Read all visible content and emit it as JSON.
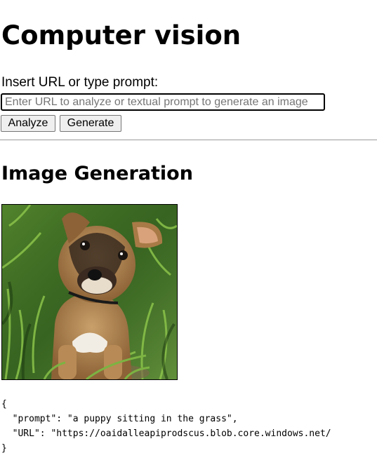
{
  "page": {
    "title": "Computer vision"
  },
  "input_section": {
    "label": "Insert URL or type prompt:",
    "input_value": "",
    "input_placeholder": "Enter URL to analyze or textual prompt to generate an image",
    "analyze_label": "Analyze",
    "generate_label": "Generate"
  },
  "result": {
    "heading": "Image Generation",
    "image_subject": "puppy-sitting-in-grass",
    "json_lines": [
      "{",
      "  \"prompt\": \"a puppy sitting in the grass\",",
      "  \"URL\": \"https://oaidalleapiprodscus.blob.core.windows.net/",
      "}"
    ]
  },
  "colors": {
    "divider": "#9a9a9a",
    "button_bg": "#efefef",
    "button_border": "#767676",
    "grass_dark": "#2f5a1c",
    "grass_light": "#6fa83a",
    "puppy_tan": "#b88a55",
    "puppy_dark": "#2a1f18"
  }
}
